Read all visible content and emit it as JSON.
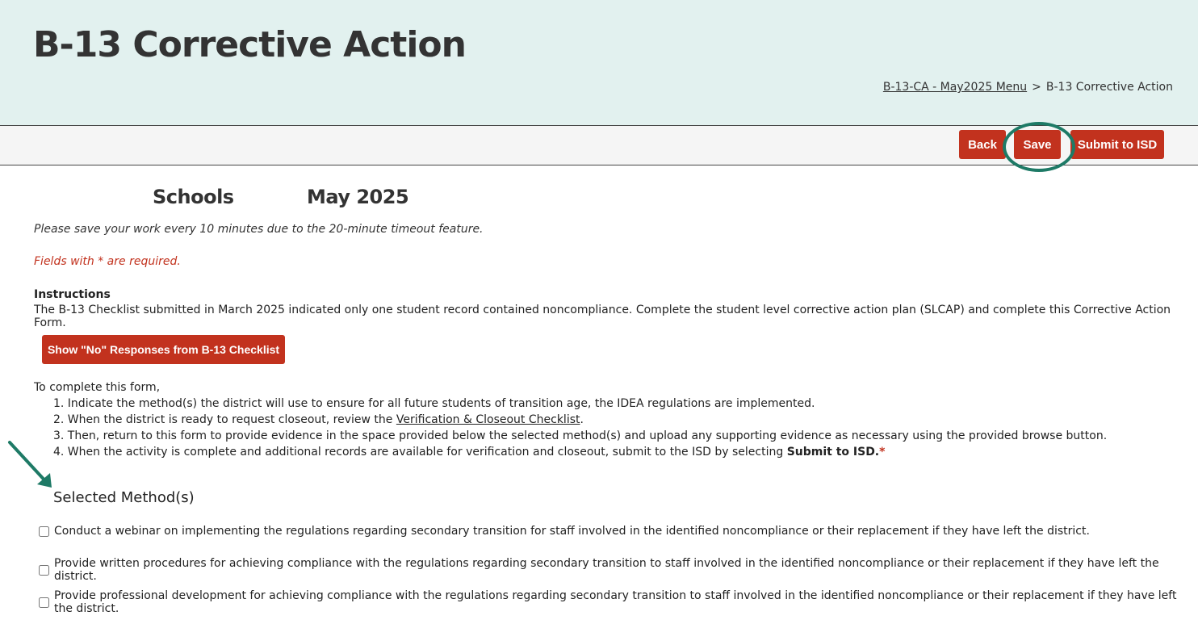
{
  "header": {
    "title": "B-13 Corrective Action",
    "breadcrumb": {
      "link": "B-13-CA - May2025 Menu",
      "separator": ">",
      "current": "B-13 Corrective Action"
    }
  },
  "toolbar": {
    "back_label": "Back",
    "save_label": "Save",
    "submit_label": "Submit to ISD"
  },
  "form": {
    "schools_label": "Schools",
    "month_label": "May 2025",
    "save_note": "Please save your work every 10 minutes due to the 20-minute timeout feature.",
    "required_note": "Fields with * are required.",
    "instructions_heading": "Instructions",
    "instructions_text": "The B-13 Checklist submitted in March 2025 indicated only one student record contained noncompliance. Complete the student level corrective action plan (SLCAP) and complete this Corrective Action Form.",
    "show_no_button": "Show \"No\" Responses from B-13 Checklist",
    "complete_intro": "To complete this form,",
    "steps": {
      "s1": "1. Indicate the method(s) the district will use to ensure for all future students of transition age, the IDEA regulations are implemented.",
      "s2_prefix": "2. When the district is ready to request closeout, review the ",
      "s2_link": "Verification & Closeout Checklist",
      "s2_suffix": ".",
      "s3": "3. Then, return to this form to provide evidence in the space provided below the selected method(s) and upload any supporting evidence as necessary using the provided browse button.",
      "s4_prefix": "4. When the activity is complete and additional records are available for verification and closeout, submit to the ISD by selecting ",
      "s4_bold": "Submit to ISD.",
      "s4_star": "*"
    },
    "methods_title": "Selected Method(s)",
    "methods": [
      {
        "label": "Conduct a webinar on implementing the regulations regarding secondary transition for staff involved in the identified noncompliance or their replacement if they have left the district.",
        "checked": false
      },
      {
        "label": "Provide written procedures for achieving compliance with the regulations regarding secondary transition to staff involved in the identified noncompliance or their replacement if they have left the district.",
        "checked": false
      },
      {
        "label": "Provide professional development for achieving compliance with the regulations regarding secondary transition to staff involved in the identified noncompliance or their replacement if they have left the district.",
        "checked": false
      }
    ]
  },
  "colors": {
    "header_bg": "#e2f1ef",
    "button_red": "#c2321e",
    "annotation_green": "#1e7a66"
  }
}
